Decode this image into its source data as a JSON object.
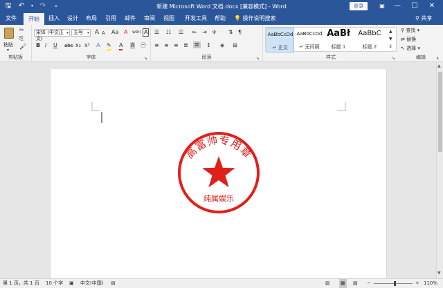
{
  "window": {
    "title": "新建 Microsoft Word 文档.docx [兼容模式] - Word",
    "login": "登录"
  },
  "tabs": [
    "文件",
    "开始",
    "插入",
    "设计",
    "布局",
    "引用",
    "邮件",
    "审阅",
    "视图",
    "开发工具",
    "帮助"
  ],
  "tell_me": "操作说明搜索",
  "share": "共享",
  "clipboard": {
    "paste": "粘贴",
    "group": "剪贴板"
  },
  "font": {
    "name": "宋体 (中文正文)",
    "size": "五号",
    "group": "字体",
    "bold": "B",
    "italic": "I",
    "underline": "U",
    "strike": "abc",
    "sub": "x₂",
    "sup": "x²",
    "grow": "A",
    "shrink": "A",
    "case": "Aa",
    "clear": "A",
    "phonetic": "wén",
    "border": "A"
  },
  "paragraph": {
    "group": "段落"
  },
  "styles": {
    "group": "样式",
    "items": [
      {
        "sample": "AaBbCcDd",
        "name": "正文",
        "selected": true
      },
      {
        "sample": "AaBbCcDd",
        "name": "无间隔",
        "selected": false
      },
      {
        "sample": "AaBł",
        "name": "标题 1",
        "selected": false
      },
      {
        "sample": "AaBbC",
        "name": "标题 2",
        "selected": false
      }
    ]
  },
  "editing": {
    "group": "编辑",
    "find": "查找",
    "replace": "替换",
    "select": "选择"
  },
  "stamp": {
    "top_text": "高富帅专用章",
    "bottom_text": "纯属娱乐",
    "color": "#e0201b"
  },
  "status": {
    "page": "第 1 页，共 1 页",
    "words": "10 个字",
    "language": "中文(中国)",
    "zoom": "110%",
    "zoom_level": 0.55,
    "minus": "−",
    "plus": "+"
  },
  "colors": {
    "accent": "#2b579a",
    "stamp": "#e0201b"
  }
}
